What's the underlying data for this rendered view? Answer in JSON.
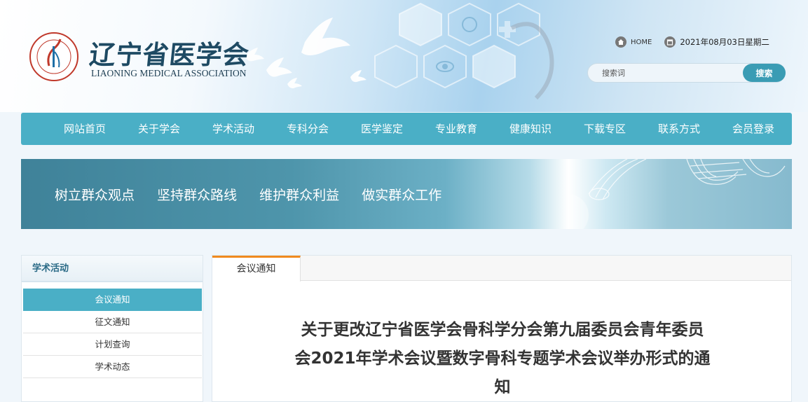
{
  "header": {
    "logo_cn": "辽宁省医学会",
    "logo_en": "LIAONING MEDICAL ASSOCIATION",
    "home_label": "HOME",
    "date_label": "2021年08月03日星期二",
    "search_placeholder": "搜索词",
    "search_button": "搜索"
  },
  "nav": {
    "items": [
      {
        "label": "网站首页"
      },
      {
        "label": "关于学会"
      },
      {
        "label": "学术活动"
      },
      {
        "label": "专科分会"
      },
      {
        "label": "医学鉴定"
      },
      {
        "label": "专业教育"
      },
      {
        "label": "健康知识"
      },
      {
        "label": "下载专区"
      },
      {
        "label": "联系方式"
      },
      {
        "label": "会员登录"
      }
    ]
  },
  "banner": {
    "slogans": [
      "树立群众观点",
      "坚持群众路线",
      "维护群众利益",
      "做实群众工作"
    ]
  },
  "sidebar": {
    "title": "学术活动",
    "items": [
      {
        "label": "会议通知",
        "active": true
      },
      {
        "label": "征文通知",
        "active": false
      },
      {
        "label": "计划查询",
        "active": false
      },
      {
        "label": "学术动态",
        "active": false
      }
    ]
  },
  "main": {
    "tab_label": "会议通知",
    "article_title_lines": [
      "关于更改辽宁省医学会骨科学分会第九届委员会青年委员",
      "会2021年学术会议暨数字骨科专题学术会议举办形式的通",
      "知"
    ]
  },
  "colors": {
    "accent": "#4aafc6",
    "tab_accent": "#f08a1e",
    "logo_text": "#1e4a63",
    "search_button": "#3a9cb4"
  },
  "icons": [
    "home-icon",
    "calendar-icon",
    "logo-emblem-icon",
    "dove-icon",
    "medical-hexagon-icon"
  ]
}
